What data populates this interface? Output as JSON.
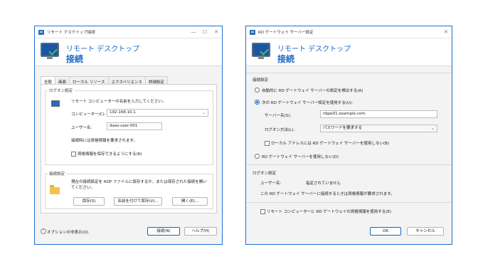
{
  "left": {
    "title": "リモート デスクトップ接続",
    "header_line1": "リモート デスクトップ",
    "header_line2": "接続",
    "tabs": [
      "全般",
      "画面",
      "ローカル リソース",
      "エクスペリエンス",
      "詳細設定"
    ],
    "logon": {
      "group_label": "ログオン設定",
      "instruction": "リモート コンピューターの名前を入力してください。",
      "computer_label": "コンピューター(C):",
      "computer_value": "192.168.10.1",
      "user_label": "ユーザー名:",
      "user_value": "daas-user-001",
      "note": "接続時には資格情報を要求されます。",
      "save_cred_label": "資格情報を保存できるようにする(R)"
    },
    "conn": {
      "group_label": "接続設定",
      "desc": "現在の接続設定を RDP ファイルに保存するか、または保存された接続を開いてください。",
      "save": "保存(S)",
      "save_as": "名前を付けて保存(V)...",
      "open": "開く(E)..."
    },
    "options": "オプションの非表示(O)",
    "connect": "接続(N)",
    "help": "ヘルプ(H)"
  },
  "right": {
    "title": "RD ゲートウェイ サーバー設定",
    "header_line1": "リモート デスクトップ",
    "header_line2": "接続",
    "conn_group": "接続設定",
    "auto_detect": "自動的に RD ゲートウェイ サーバーの設定を検出する(A)",
    "use_settings": "次の RD ゲートウェイ サーバー設定を使用する(U):",
    "server_label": "サーバー名(S):",
    "server_value": "rdgw01.example.com",
    "logon_method_label": "ログオン方法(L):",
    "logon_method_value": "パスワードを要求する",
    "bypass_local": "ローカル アドレスには RD ゲートウェイ サーバーを使用しない(B)",
    "no_gateway": "RD ゲートウェイ サーバーを使用しない(D)",
    "logon_group": "ログオン設定",
    "user_label": "ユーザー名:",
    "user_value": "指定されていません",
    "cred_note": "この RD ゲートウェイ サーバーに接続するときは資格情報が要求されます。",
    "use_cred": "リモート コンピューターに RD ゲートウェイの資格情報を使用する(E)",
    "ok": "OK",
    "cancel": "キャンセル"
  }
}
